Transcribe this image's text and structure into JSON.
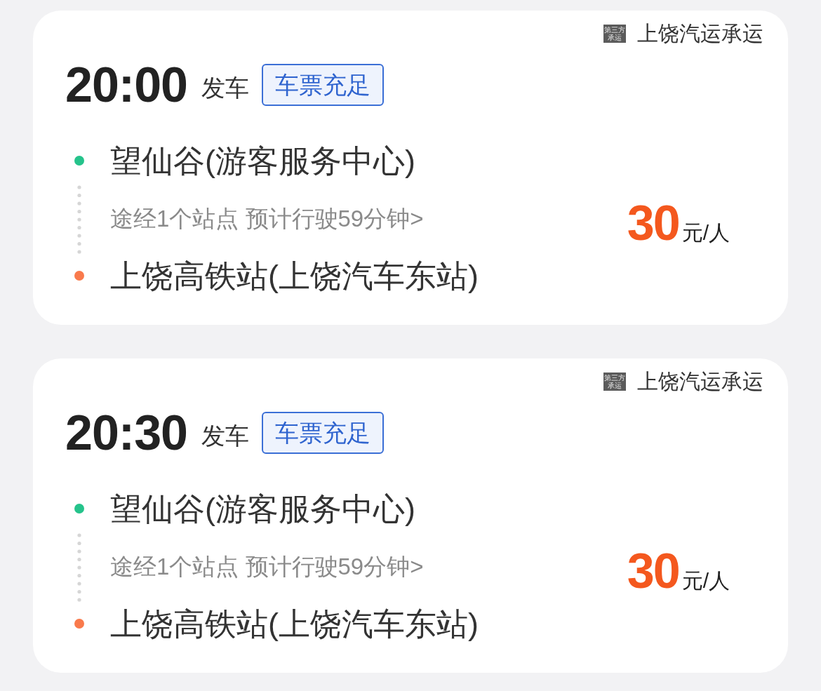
{
  "trips": [
    {
      "carrier": {
        "badge": "第三方承运",
        "name": "上饶汽运承运"
      },
      "departure_time": "20:00",
      "departure_label": "发车",
      "ticket_status": "车票充足",
      "stops": [
        {
          "kind": "origin",
          "name": "望仙谷(游客服务中心)",
          "color": "#25c38b"
        },
        {
          "kind": "via",
          "text": "途经1个站点 预计行驶59分钟>"
        },
        {
          "kind": "destination",
          "name": "上饶高铁站(上饶汽车东站)",
          "color": "#f97a4c"
        }
      ],
      "price": {
        "amount": "30",
        "unit": "元/人"
      }
    },
    {
      "carrier": {
        "badge": "第三方承运",
        "name": "上饶汽运承运"
      },
      "departure_time": "20:30",
      "departure_label": "发车",
      "ticket_status": "车票充足",
      "stops": [
        {
          "kind": "origin",
          "name": "望仙谷(游客服务中心)",
          "color": "#25c38b"
        },
        {
          "kind": "via",
          "text": "途经1个站点 预计行驶59分钟>"
        },
        {
          "kind": "destination",
          "name": "上饶高铁站(上饶汽车东站)",
          "color": "#f97a4c"
        }
      ],
      "price": {
        "amount": "30",
        "unit": "元/人"
      }
    }
  ]
}
